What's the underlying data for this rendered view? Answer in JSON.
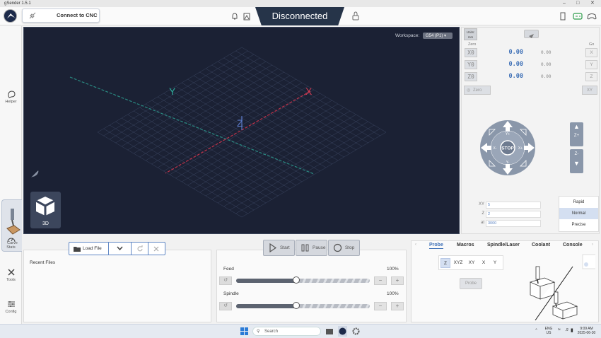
{
  "app": {
    "title": "gSender 1.5.1"
  },
  "topbar": {
    "connect_label": "Connect to CNC",
    "status": "Disconnected"
  },
  "sidebar": {
    "items": [
      {
        "label": "Helper",
        "icon": "help-bubble-icon"
      },
      {
        "label": "Carve",
        "icon": "carve-icon"
      },
      {
        "label": "Stats",
        "icon": "gauge-icon"
      },
      {
        "label": "Tools",
        "icon": "tools-icon"
      },
      {
        "label": "Config",
        "icon": "sliders-icon"
      }
    ]
  },
  "visualizer": {
    "workspace_label": "Workspace:",
    "workspace_value": "G54 (P1)",
    "axes": {
      "x": "X",
      "y": "Y",
      "z": "Z"
    },
    "view_label": "3D"
  },
  "dro": {
    "units": "Units: mm",
    "zero_label": "Zero",
    "go_label": "Go",
    "axes": [
      {
        "axis": "X0",
        "wpos": "0.00",
        "mpos": "0.00",
        "go": "X"
      },
      {
        "axis": "Y0",
        "wpos": "0.00",
        "mpos": "0.00",
        "go": "Y"
      },
      {
        "axis": "Z0",
        "wpos": "0.00",
        "mpos": "0.00",
        "go": "Z"
      }
    ],
    "zero_all": "Zero",
    "go_xy": "XY"
  },
  "jog": {
    "stop": "STOP",
    "y_plus": "Y+",
    "y_minus": "Y-",
    "x_plus": "X+",
    "x_minus": "X-",
    "z_plus": "Z+",
    "z_minus": "Z-",
    "fields": [
      {
        "label": "XY",
        "value": "5"
      },
      {
        "label": "Z",
        "value": "2"
      },
      {
        "label": "at",
        "value": "3000"
      }
    ],
    "speeds": [
      "Rapid",
      "Normal",
      "Precise"
    ],
    "speed_selected": "Normal"
  },
  "files": {
    "load_label": "Load File",
    "recent_label": "Recent Files"
  },
  "controls": {
    "start": "Start",
    "pause": "Pause",
    "stop": "Stop"
  },
  "overrides": {
    "feed": {
      "label": "Feed",
      "percent": "100%",
      "fraction": 0.45
    },
    "spindle": {
      "label": "Spindle",
      "percent": "100%",
      "fraction": 0.45
    }
  },
  "tools_panel": {
    "tabs": [
      "Probe",
      "Macros",
      "Spindle/Laser",
      "Coolant",
      "Console"
    ],
    "active_tab": "Probe",
    "probe_axes": [
      "Z",
      "XYZ",
      "XY",
      "X",
      "Y"
    ],
    "probe_selected": "Z",
    "probe_button": "Probe"
  },
  "taskbar": {
    "search": "Search",
    "lang_1": "ENG",
    "lang_2": "US",
    "time": "9:09 AM",
    "date": "2025-06-30"
  },
  "colors": {
    "accent": "#3d6fb6",
    "visualizer_bg": "#1b2134",
    "status_bg": "#263449"
  }
}
